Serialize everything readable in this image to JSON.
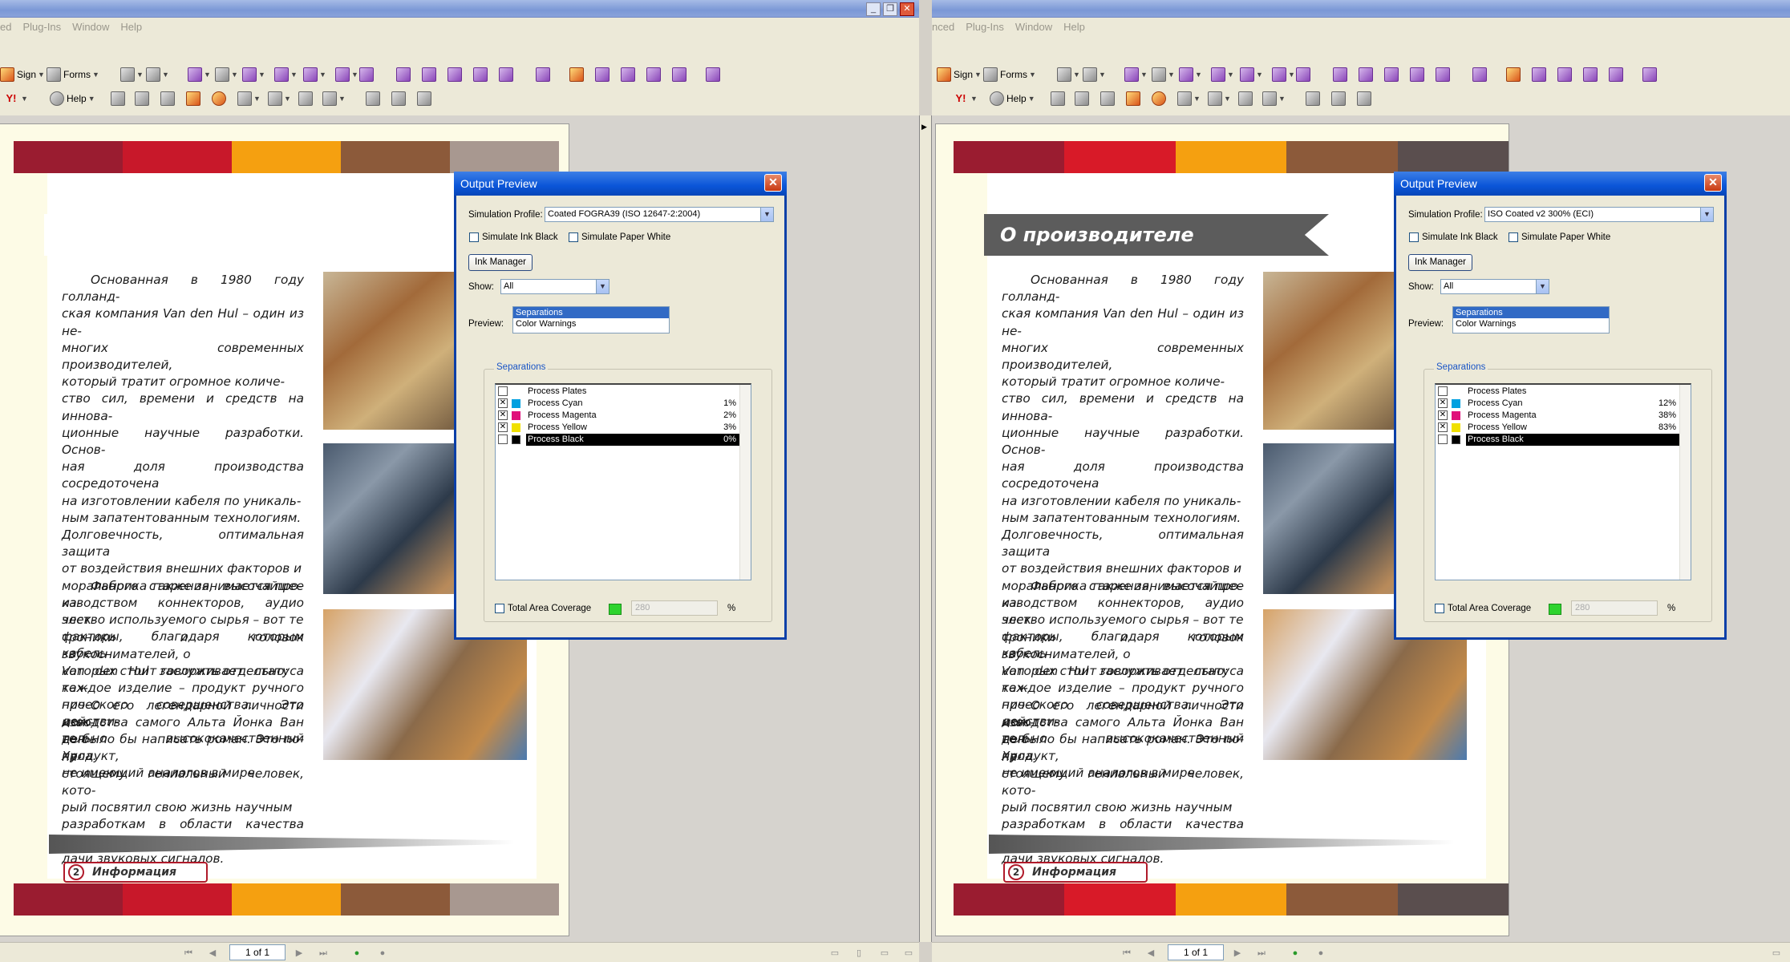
{
  "window_controls": {
    "minimize": "_",
    "restore": "❐",
    "close": "✕"
  },
  "left": {
    "menu": [
      "ed",
      "Plug-Ins",
      "Window",
      "Help"
    ],
    "toolbar": {
      "sign": "Sign",
      "forms": "Forms",
      "help": "Help"
    },
    "heading": "",
    "dialog": {
      "title": "Output Preview",
      "simulation_profile_label": "Simulation Profile:",
      "simulation_profile_value": "Coated FOGRA39 (ISO 12647-2:2004)",
      "simulate_ink_black": "Simulate Ink Black",
      "simulate_paper_white": "Simulate Paper White",
      "ink_manager": "Ink Manager",
      "show_label": "Show:",
      "show_value": "All",
      "preview_label": "Preview:",
      "preview_options": [
        "Separations",
        "Color Warnings"
      ],
      "separations_group": "Separations",
      "separations": [
        {
          "name": "Process Plates",
          "percent": "",
          "color": "",
          "checked": false
        },
        {
          "name": "Process Cyan",
          "percent": "1%",
          "color": "#00a0e0",
          "checked": true
        },
        {
          "name": "Process Magenta",
          "percent": "2%",
          "color": "#e0107a",
          "checked": true
        },
        {
          "name": "Process Yellow",
          "percent": "3%",
          "color": "#f0e000",
          "checked": true
        },
        {
          "name": "Process Black",
          "percent": "0%",
          "color": "#000000",
          "checked": false
        }
      ],
      "total_area_coverage": "Total Area Coverage",
      "tac_value": "280",
      "percent_sign": "%"
    },
    "status": {
      "page": "1 of 1"
    }
  },
  "right": {
    "menu": [
      "nced",
      "Plug-Ins",
      "Window",
      "Help"
    ],
    "toolbar": {
      "sign": "Sign",
      "forms": "Forms",
      "help": "Help"
    },
    "heading": "О производителе",
    "dialog": {
      "title": "Output Preview",
      "simulation_profile_label": "Simulation Profile:",
      "simulation_profile_value": "ISO Coated v2 300% (ECI)",
      "simulate_ink_black": "Simulate Ink Black",
      "simulate_paper_white": "Simulate Paper White",
      "ink_manager": "Ink Manager",
      "show_label": "Show:",
      "show_value": "All",
      "preview_label": "Preview:",
      "preview_options": [
        "Separations",
        "Color Warnings"
      ],
      "separations_group": "Separations",
      "separations": [
        {
          "name": "Process Plates",
          "percent": "",
          "color": "",
          "checked": false
        },
        {
          "name": "Process Cyan",
          "percent": "12%",
          "color": "#00a0e0",
          "checked": true
        },
        {
          "name": "Process Magenta",
          "percent": "38%",
          "color": "#e0107a",
          "checked": true
        },
        {
          "name": "Process Yellow",
          "percent": "83%",
          "color": "#f0e000",
          "checked": true
        },
        {
          "name": "Process Black",
          "percent": "",
          "color": "#000000",
          "checked": false
        }
      ],
      "total_area_coverage": "Total Area Coverage",
      "tac_value": "280",
      "percent_sign": "%"
    },
    "status": {
      "page": "1 of 1"
    }
  },
  "article": {
    "p1": "Основанная в 1980 году голланд-\nская компания Van den Hul – один из не-\nмногих современных производителей,\nкоторый тратит огромное количе-\nство сил, времени и средств на иннова-\nционные научные разработки. Основ-\nная доля производства сосредоточена\nна изготовлении кабеля по уникаль-\nным запатентованным технологиям.\nДолговечность, оптимальная защита\nот воздействия внешних факторов и\nморального старения, высочайшее ка-\nчество используемого сырья – вот те\nфакторы, благодаря которым кабель\nVan den Hul заслуживает статуса тех-\nнического совершенства. Это действи-\nтельно высококачественный продукт,\nне имеющий аналогов в мире.",
    "p2": "Фабрика также занимается про-\nизводством коннекторов, аудио элек-\nтроники и головок звукоснимателей, о\nкоторых стоит говорить отдельно:\nкаждое изделие – продукт ручного про-\nизводства самого Альта Йонка Ван ден\nХула.",
    "p3": "О его легендарной личности мож-\nно было бы написать роман. Это по-на-\nстоящему гениальный человек, кото-\nрый посвятил свою жизнь научным\nразработкам в области качества пере-\nдачи звуковых сигналов."
  },
  "footer": {
    "page_number": "2",
    "section": "Информация"
  },
  "colors": {
    "left_bars": [
      "#9a1c30",
      "#c8182a",
      "#f5a010",
      "#8c5a3a",
      "#a89890"
    ],
    "right_bars": [
      "#9a1c30",
      "#d81a28",
      "#f5a010",
      "#8c5a3a",
      "#5a4e4e"
    ],
    "accent": "#0a55d8"
  }
}
